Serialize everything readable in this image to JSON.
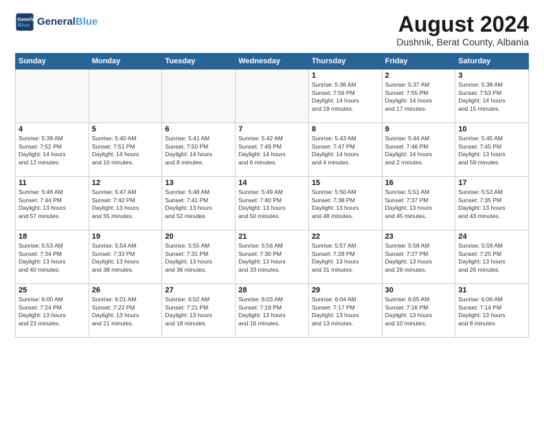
{
  "header": {
    "logo_line1": "General",
    "logo_line2": "Blue",
    "main_title": "August 2024",
    "subtitle": "Dushnik, Berat County, Albania"
  },
  "weekdays": [
    "Sunday",
    "Monday",
    "Tuesday",
    "Wednesday",
    "Thursday",
    "Friday",
    "Saturday"
  ],
  "weeks": [
    [
      {
        "day": "",
        "info": ""
      },
      {
        "day": "",
        "info": ""
      },
      {
        "day": "",
        "info": ""
      },
      {
        "day": "",
        "info": ""
      },
      {
        "day": "1",
        "info": "Sunrise: 5:36 AM\nSunset: 7:56 PM\nDaylight: 14 hours\nand 19 minutes."
      },
      {
        "day": "2",
        "info": "Sunrise: 5:37 AM\nSunset: 7:55 PM\nDaylight: 14 hours\nand 17 minutes."
      },
      {
        "day": "3",
        "info": "Sunrise: 5:38 AM\nSunset: 7:53 PM\nDaylight: 14 hours\nand 15 minutes."
      }
    ],
    [
      {
        "day": "4",
        "info": "Sunrise: 5:39 AM\nSunset: 7:52 PM\nDaylight: 14 hours\nand 12 minutes."
      },
      {
        "day": "5",
        "info": "Sunrise: 5:40 AM\nSunset: 7:51 PM\nDaylight: 14 hours\nand 10 minutes."
      },
      {
        "day": "6",
        "info": "Sunrise: 5:41 AM\nSunset: 7:50 PM\nDaylight: 14 hours\nand 8 minutes."
      },
      {
        "day": "7",
        "info": "Sunrise: 5:42 AM\nSunset: 7:49 PM\nDaylight: 14 hours\nand 6 minutes."
      },
      {
        "day": "8",
        "info": "Sunrise: 5:43 AM\nSunset: 7:47 PM\nDaylight: 14 hours\nand 4 minutes."
      },
      {
        "day": "9",
        "info": "Sunrise: 5:44 AM\nSunset: 7:46 PM\nDaylight: 14 hours\nand 2 minutes."
      },
      {
        "day": "10",
        "info": "Sunrise: 5:45 AM\nSunset: 7:45 PM\nDaylight: 13 hours\nand 59 minutes."
      }
    ],
    [
      {
        "day": "11",
        "info": "Sunrise: 5:46 AM\nSunset: 7:44 PM\nDaylight: 13 hours\nand 57 minutes."
      },
      {
        "day": "12",
        "info": "Sunrise: 5:47 AM\nSunset: 7:42 PM\nDaylight: 13 hours\nand 55 minutes."
      },
      {
        "day": "13",
        "info": "Sunrise: 5:48 AM\nSunset: 7:41 PM\nDaylight: 13 hours\nand 52 minutes."
      },
      {
        "day": "14",
        "info": "Sunrise: 5:49 AM\nSunset: 7:40 PM\nDaylight: 13 hours\nand 50 minutes."
      },
      {
        "day": "15",
        "info": "Sunrise: 5:50 AM\nSunset: 7:38 PM\nDaylight: 13 hours\nand 48 minutes."
      },
      {
        "day": "16",
        "info": "Sunrise: 5:51 AM\nSunset: 7:37 PM\nDaylight: 13 hours\nand 45 minutes."
      },
      {
        "day": "17",
        "info": "Sunrise: 5:52 AM\nSunset: 7:35 PM\nDaylight: 13 hours\nand 43 minutes."
      }
    ],
    [
      {
        "day": "18",
        "info": "Sunrise: 5:53 AM\nSunset: 7:34 PM\nDaylight: 13 hours\nand 40 minutes."
      },
      {
        "day": "19",
        "info": "Sunrise: 5:54 AM\nSunset: 7:33 PM\nDaylight: 13 hours\nand 38 minutes."
      },
      {
        "day": "20",
        "info": "Sunrise: 5:55 AM\nSunset: 7:31 PM\nDaylight: 13 hours\nand 36 minutes."
      },
      {
        "day": "21",
        "info": "Sunrise: 5:56 AM\nSunset: 7:30 PM\nDaylight: 13 hours\nand 33 minutes."
      },
      {
        "day": "22",
        "info": "Sunrise: 5:57 AM\nSunset: 7:28 PM\nDaylight: 13 hours\nand 31 minutes."
      },
      {
        "day": "23",
        "info": "Sunrise: 5:58 AM\nSunset: 7:27 PM\nDaylight: 13 hours\nand 28 minutes."
      },
      {
        "day": "24",
        "info": "Sunrise: 5:59 AM\nSunset: 7:25 PM\nDaylight: 13 hours\nand 26 minutes."
      }
    ],
    [
      {
        "day": "25",
        "info": "Sunrise: 6:00 AM\nSunset: 7:24 PM\nDaylight: 13 hours\nand 23 minutes."
      },
      {
        "day": "26",
        "info": "Sunrise: 6:01 AM\nSunset: 7:22 PM\nDaylight: 13 hours\nand 21 minutes."
      },
      {
        "day": "27",
        "info": "Sunrise: 6:02 AM\nSunset: 7:21 PM\nDaylight: 13 hours\nand 18 minutes."
      },
      {
        "day": "28",
        "info": "Sunrise: 6:03 AM\nSunset: 7:19 PM\nDaylight: 13 hours\nand 16 minutes."
      },
      {
        "day": "29",
        "info": "Sunrise: 6:04 AM\nSunset: 7:17 PM\nDaylight: 13 hours\nand 13 minutes."
      },
      {
        "day": "30",
        "info": "Sunrise: 6:05 AM\nSunset: 7:16 PM\nDaylight: 13 hours\nand 10 minutes."
      },
      {
        "day": "31",
        "info": "Sunrise: 6:06 AM\nSunset: 7:14 PM\nDaylight: 13 hours\nand 8 minutes."
      }
    ]
  ]
}
